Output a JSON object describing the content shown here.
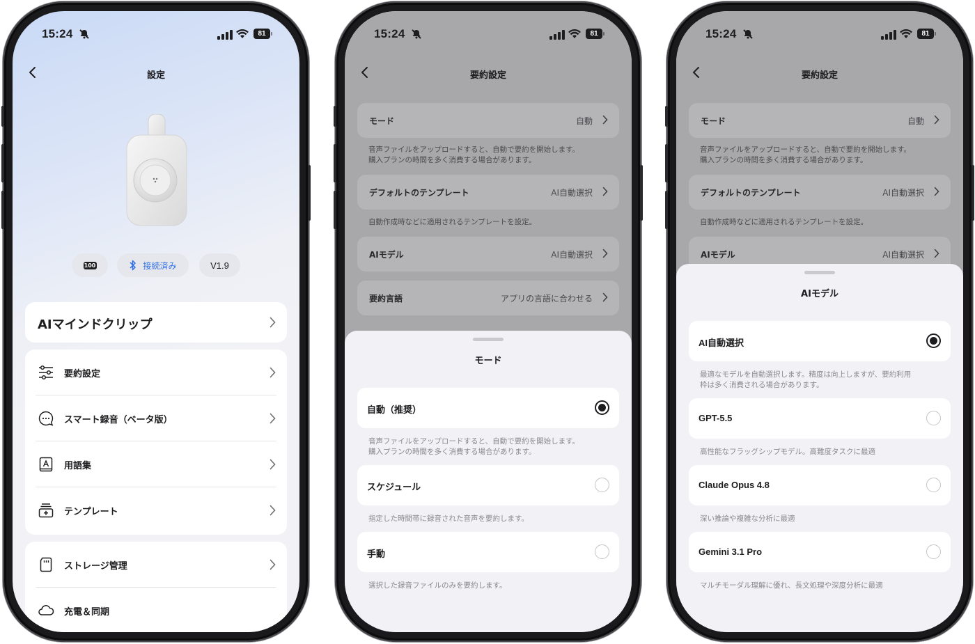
{
  "status": {
    "time": "15:24",
    "battery": "81"
  },
  "screen1": {
    "title": "設定",
    "chips": {
      "battery": "100",
      "connection": "接続済み",
      "version": "V1.9"
    },
    "device_name": "AIマインドクリップ",
    "menu": [
      {
        "label": "要約設定",
        "icon": "sliders-icon"
      },
      {
        "label": "スマート録音（ベータ版）",
        "icon": "chat-bubble-icon"
      },
      {
        "label": "用語集",
        "icon": "glossary-icon"
      },
      {
        "label": "テンプレート",
        "icon": "template-icon"
      }
    ],
    "storage": {
      "label": "ストレージ管理",
      "partial_label": "充電＆同期"
    }
  },
  "screen2": {
    "title": "要約設定",
    "rows": {
      "mode": {
        "label": "モード",
        "value": "自動"
      },
      "mode_desc": "音声ファイルをアップロードすると、自動で要約を開始します。\n購入プランの時間を多く消費する場合があります。",
      "template": {
        "label": "デフォルトのテンプレート",
        "value": "AI自動選択"
      },
      "template_desc": "自動作成時などに適用されるテンプレートを設定。",
      "model": {
        "label": "AIモデル",
        "value": "AI自動選択"
      },
      "language": {
        "label": "要約言語",
        "value": "アプリの言語に合わせる"
      }
    },
    "sheet": {
      "title": "モード",
      "options": [
        {
          "label": "自動（推奨）",
          "selected": true,
          "desc": "音声ファイルをアップロードすると、自動で要約を開始します。\n購入プランの時間を多く消費する場合があります。"
        },
        {
          "label": "スケジュール",
          "selected": false,
          "desc": "指定した時間帯に録音された音声を要約します。"
        },
        {
          "label": "手動",
          "selected": false,
          "desc": "選択した録音ファイルのみを要約します。"
        }
      ]
    }
  },
  "screen3": {
    "title": "要約設定",
    "rows": {
      "mode": {
        "label": "モード",
        "value": "自動"
      },
      "mode_desc": "音声ファイルをアップロードすると、自動で要約を開始します。\n購入プランの時間を多く消費する場合があります。",
      "template": {
        "label": "デフォルトのテンプレート",
        "value": "AI自動選択"
      },
      "template_desc": "自動作成時などに適用されるテンプレートを設定。",
      "model": {
        "label": "AIモデル",
        "value": "AI自動選択"
      }
    },
    "sheet": {
      "title": "AIモデル",
      "options": [
        {
          "label": "AI自動選択",
          "selected": true,
          "desc": "最適なモデルを自動選択します。精度は向上しますが、要約利用\n枠は多く消費される場合があります。"
        },
        {
          "label": "GPT-5.5",
          "selected": false,
          "desc": "高性能なフラッグシップモデル。高難度タスクに最適"
        },
        {
          "label": "Claude Opus 4.8",
          "selected": false,
          "desc": "深い推論や複雑な分析に最適"
        },
        {
          "label": "Gemini 3.1 Pro",
          "selected": false,
          "desc": "マルチモーダル理解に優れ、長文処理や深度分析に最適"
        }
      ]
    }
  }
}
